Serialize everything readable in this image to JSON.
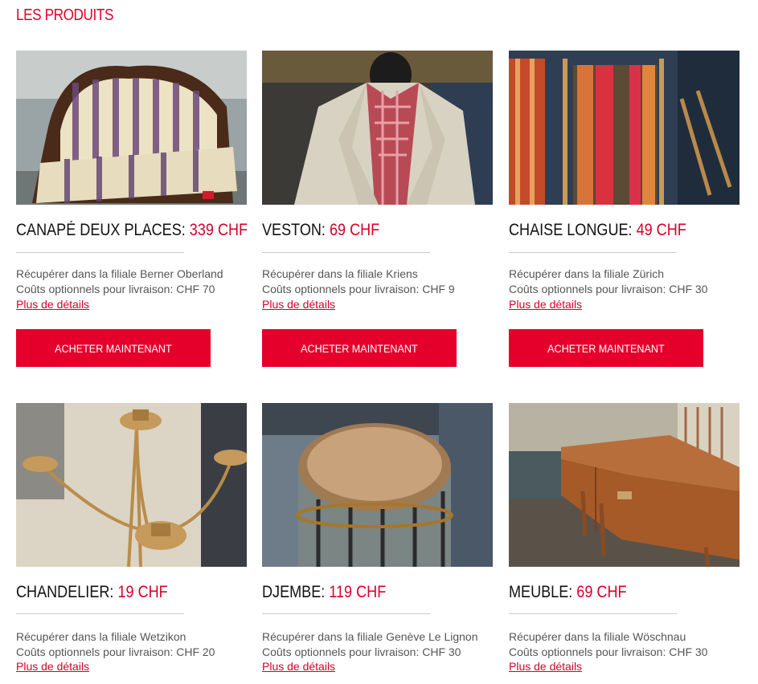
{
  "section_title": "LES PRODUITS",
  "buy_label": "ACHETER MAINTENANT",
  "products": [
    {
      "name": "CANAPÉ DEUX PLACES",
      "price": "339 CHF",
      "pickup": "Récupérer dans la filiale Berner Oberland",
      "delivery": "Coûts optionnels pour livraison: CHF 70",
      "link": "Plus de détails",
      "image": "sofa-photo"
    },
    {
      "name": "VESTON",
      "price": "69 CHF",
      "pickup": "Récupérer dans la filiale Kriens",
      "delivery": "Coûts optionnels pour livraison: CHF 9",
      "link": "Plus de détails",
      "image": "jacket-photo"
    },
    {
      "name": "CHAISE LONGUE",
      "price": "49 CHF",
      "pickup": "Récupérer dans la filiale Zürich",
      "delivery": "Coûts optionnels pour livraison: CHF 30",
      "link": "Plus de détails",
      "image": "deckchair-photo"
    },
    {
      "name": "CHANDELIER",
      "price": "19 CHF",
      "pickup": "Récupérer dans la filiale Wetzikon",
      "delivery": "Coûts optionnels pour livraison: CHF 20",
      "link": "Plus de détails",
      "image": "chandelier-photo"
    },
    {
      "name": "DJEMBE",
      "price": "119 CHF",
      "pickup": "Récupérer dans la filiale Genève Le Lignon",
      "delivery": "Coûts optionnels pour livraison: CHF 30",
      "link": "Plus de détails",
      "image": "djembe-photo"
    },
    {
      "name": "MEUBLE",
      "price": "69 CHF",
      "pickup": "Récupérer dans la filiale Wöschnau",
      "delivery": "Coûts optionnels pour livraison: CHF 30",
      "link": "Plus de détails",
      "image": "sideboard-photo"
    }
  ],
  "colors": {
    "accent": "#e4002b",
    "price": "#d6002a",
    "text": "#111111",
    "muted": "#555555"
  }
}
